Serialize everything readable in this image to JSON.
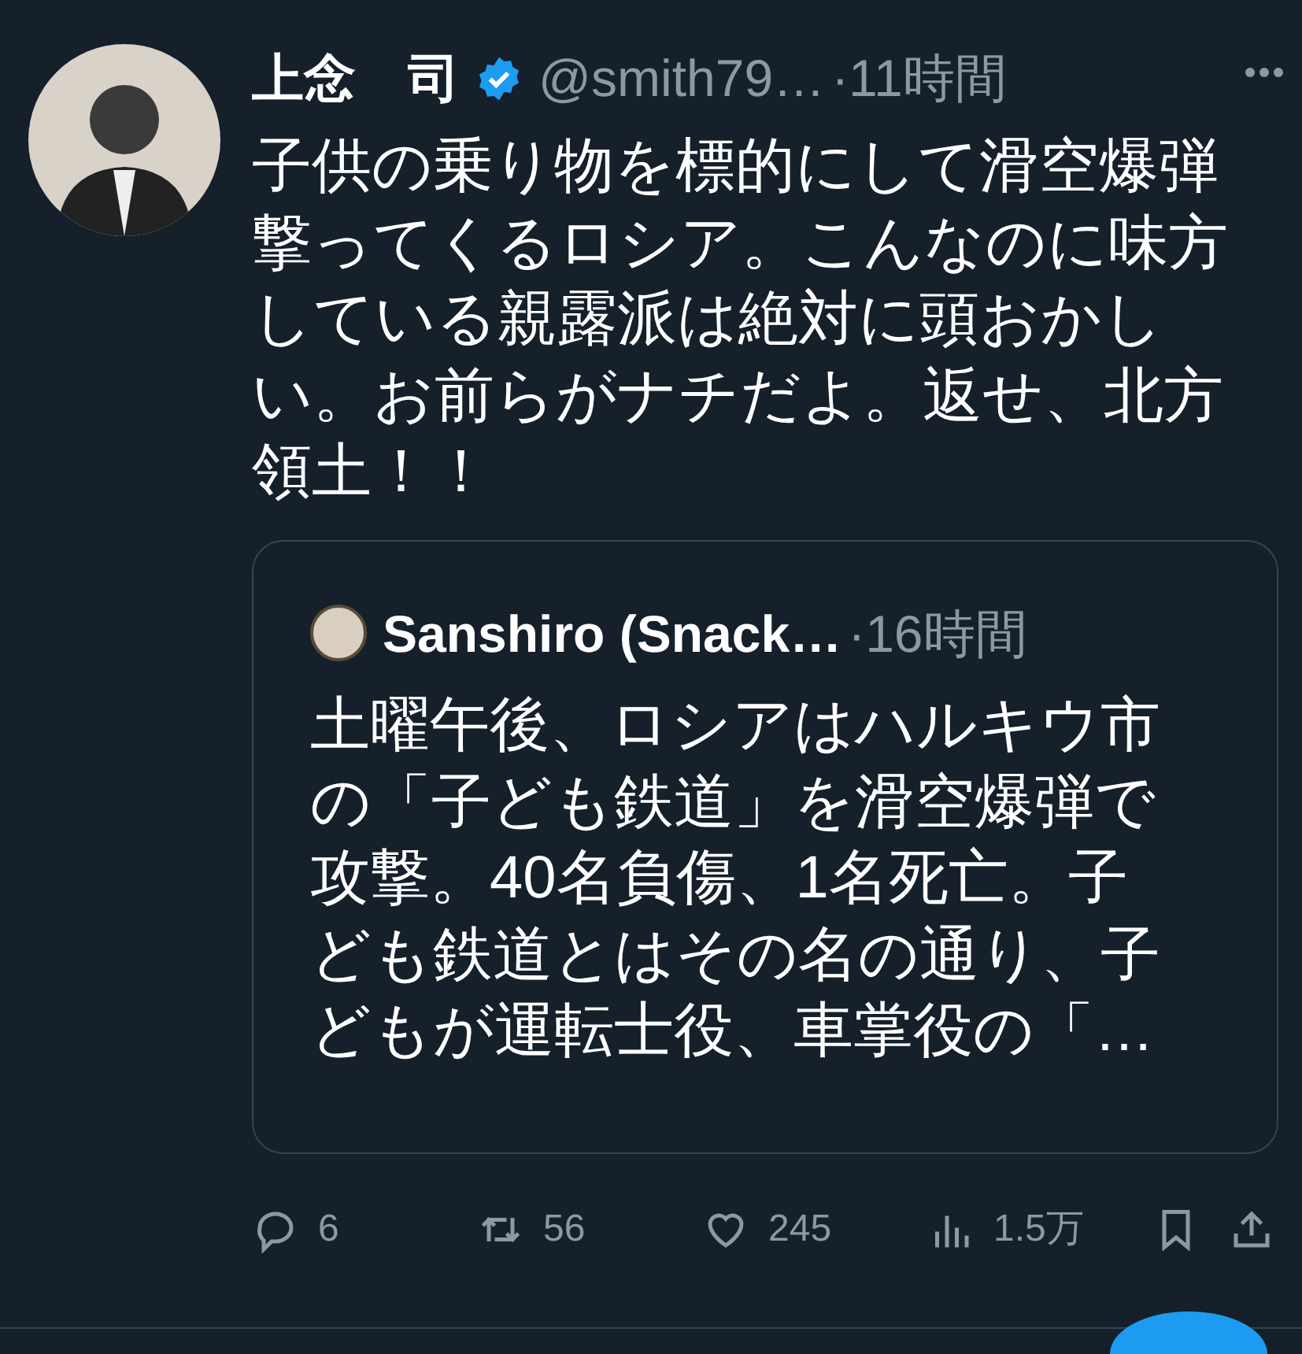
{
  "tweet": {
    "author": {
      "name": "上念　司",
      "verified": true,
      "handle": "@smith79…",
      "time": "·11時間"
    },
    "text": "子供の乗り物を標的にして滑空爆弾撃ってくるロシア。こんなのに味方している親露派は絶対に頭おかしい。お前らがナチだよ。返せ、北方領土！！",
    "quote": {
      "name": "Sanshiro (Snack…",
      "time": "·16時間",
      "text": "土曜午後、ロシアはハルキウ市の「子ども鉄道」を滑空爆弾で攻撃。40名負傷、1名死亡。子ども鉄道とはその名の通り、子どもが運転士役、車掌役の「…"
    },
    "actions": [
      {
        "kind": "reply",
        "count": "6"
      },
      {
        "kind": "retweet",
        "count": "56"
      },
      {
        "kind": "like",
        "count": "245"
      },
      {
        "kind": "views",
        "count": "1.5万"
      },
      {
        "kind": "bookmark"
      },
      {
        "kind": "share"
      }
    ]
  }
}
